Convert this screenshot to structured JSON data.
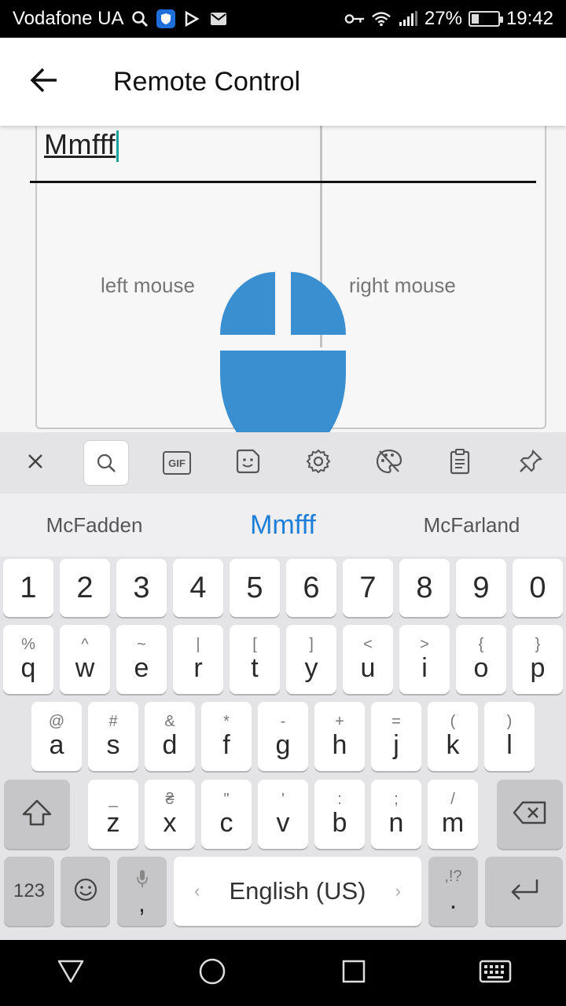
{
  "status_bar": {
    "carrier": "Vodafone UA",
    "battery_percent": "27%",
    "battery_level": 0.27,
    "time": "19:42",
    "icons": [
      "search-icon",
      "shield-icon",
      "play-store-icon",
      "mail-icon",
      "key-icon",
      "wifi-icon",
      "signal-icon",
      "battery-icon"
    ]
  },
  "app_bar": {
    "title": "Remote Control",
    "back_icon": "arrow-back-icon"
  },
  "remote": {
    "text_value": "Mmfff",
    "left_mouse_label": "left mouse",
    "right_mouse_label": "right mouse",
    "accent_color": "#3a8fd0"
  },
  "keyboard_toolbar": {
    "items": [
      "close-icon",
      "search-icon",
      "gif-icon",
      "sticker-icon",
      "settings-icon",
      "theme-icon",
      "clipboard-icon",
      "pin-icon"
    ],
    "gif_label": "GIF"
  },
  "suggestions": [
    "McFadden",
    "Mmfff",
    "McFarland"
  ],
  "keyboard": {
    "numbers": [
      "1",
      "2",
      "3",
      "4",
      "5",
      "6",
      "7",
      "8",
      "9",
      "0"
    ],
    "row1": [
      {
        "pri": "q",
        "sec": "%"
      },
      {
        "pri": "w",
        "sec": "^"
      },
      {
        "pri": "e",
        "sec": "~"
      },
      {
        "pri": "r",
        "sec": "|"
      },
      {
        "pri": "t",
        "sec": "["
      },
      {
        "pri": "y",
        "sec": "]"
      },
      {
        "pri": "u",
        "sec": "<"
      },
      {
        "pri": "i",
        "sec": ">"
      },
      {
        "pri": "o",
        "sec": "{"
      },
      {
        "pri": "p",
        "sec": "}"
      }
    ],
    "row2": [
      {
        "pri": "a",
        "sec": "@"
      },
      {
        "pri": "s",
        "sec": "#"
      },
      {
        "pri": "d",
        "sec": "&"
      },
      {
        "pri": "f",
        "sec": "*"
      },
      {
        "pri": "g",
        "sec": "-"
      },
      {
        "pri": "h",
        "sec": "+"
      },
      {
        "pri": "j",
        "sec": "="
      },
      {
        "pri": "k",
        "sec": "("
      },
      {
        "pri": "l",
        "sec": ")"
      }
    ],
    "row3": [
      {
        "pri": "z",
        "sec": "_"
      },
      {
        "pri": "x",
        "sec": "₴"
      },
      {
        "pri": "c",
        "sec": "\""
      },
      {
        "pri": "v",
        "sec": "'"
      },
      {
        "pri": "b",
        "sec": ":"
      },
      {
        "pri": "n",
        "sec": ";"
      },
      {
        "pri": "m",
        "sec": "/"
      }
    ],
    "symbols_key": "123",
    "comma_key": ",",
    "space_label": "English (US)",
    "period_key": ".",
    "period_sec": ",!?"
  },
  "nav_bar": {
    "icons": [
      "back-triangle-icon",
      "home-circle-icon",
      "recents-square-icon",
      "keyboard-hide-icon"
    ]
  }
}
